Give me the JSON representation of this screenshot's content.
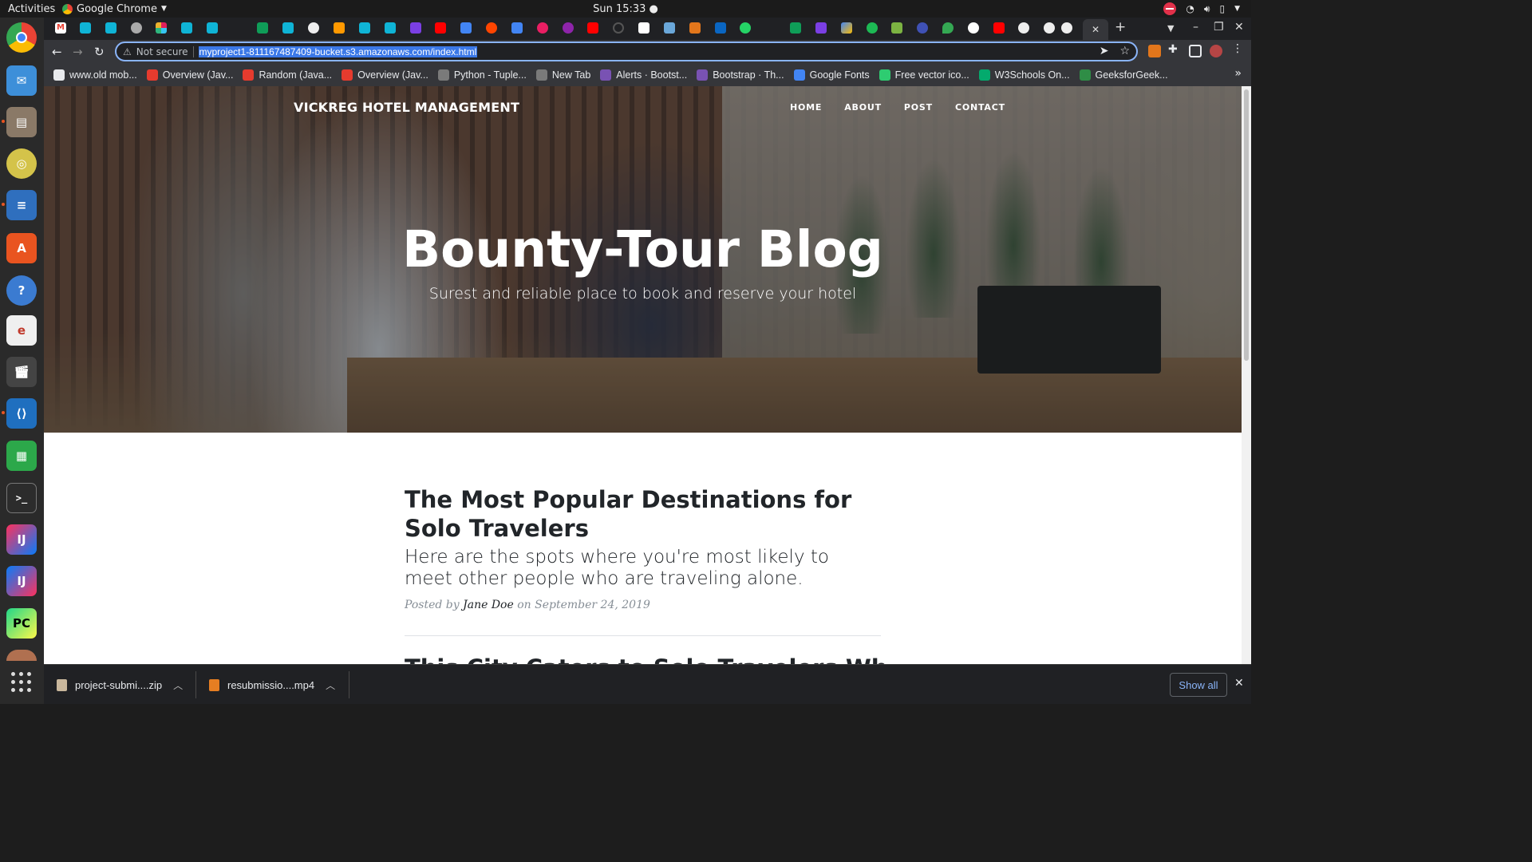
{
  "system": {
    "activities": "Activities",
    "app_name": "Google Chrome",
    "clock": "Sun 15:33 ●"
  },
  "browser": {
    "address_warning": "Not secure",
    "url": "myproject1-811167487409-bucket.s3.amazonaws.com/index.html",
    "bookmarks": [
      {
        "label": "www.old mob...",
        "color": "#e8eaed"
      },
      {
        "label": "Overview (Jav...",
        "color": "#e63b2e"
      },
      {
        "label": "Random (Java...",
        "color": "#e63b2e"
      },
      {
        "label": "Overview (Jav...",
        "color": "#e63b2e"
      },
      {
        "label": "Python - Tuple...",
        "color": "#7a7a7a"
      },
      {
        "label": "New Tab",
        "color": "#7a7a7a"
      },
      {
        "label": "Alerts · Bootst...",
        "color": "#7952b3"
      },
      {
        "label": "Bootstrap · Th...",
        "color": "#7952b3"
      },
      {
        "label": "Google Fonts",
        "color": "#4285f4"
      },
      {
        "label": "Free vector ico...",
        "color": "#2ecc71"
      },
      {
        "label": "W3Schools On...",
        "color": "#04aa6d"
      },
      {
        "label": "GeeksforGeek...",
        "color": "#2f8d46"
      }
    ]
  },
  "site": {
    "brand": "VICKREG HOTEL MANAGEMENT",
    "nav": [
      "HOME",
      "ABOUT",
      "POST",
      "CONTACT"
    ],
    "hero_title": "Bounty-Tour Blog",
    "hero_subtitle": "Surest and reliable place to book and reserve your hotel",
    "posts": [
      {
        "title": "The Most Popular Destinations for Solo Travelers",
        "subtitle": "Here are the spots where you're most likely to meet other people who are traveling alone.",
        "meta_prefix": "Posted by",
        "author": "Jane Doe",
        "meta_on": "on",
        "date": "September 24, 2019"
      },
      {
        "title": "This City Caters to Solo Travelers Wh"
      }
    ]
  },
  "downloads": {
    "items": [
      "project-submi....zip",
      "resubmissio....mp4"
    ],
    "show_all": "Show all"
  }
}
